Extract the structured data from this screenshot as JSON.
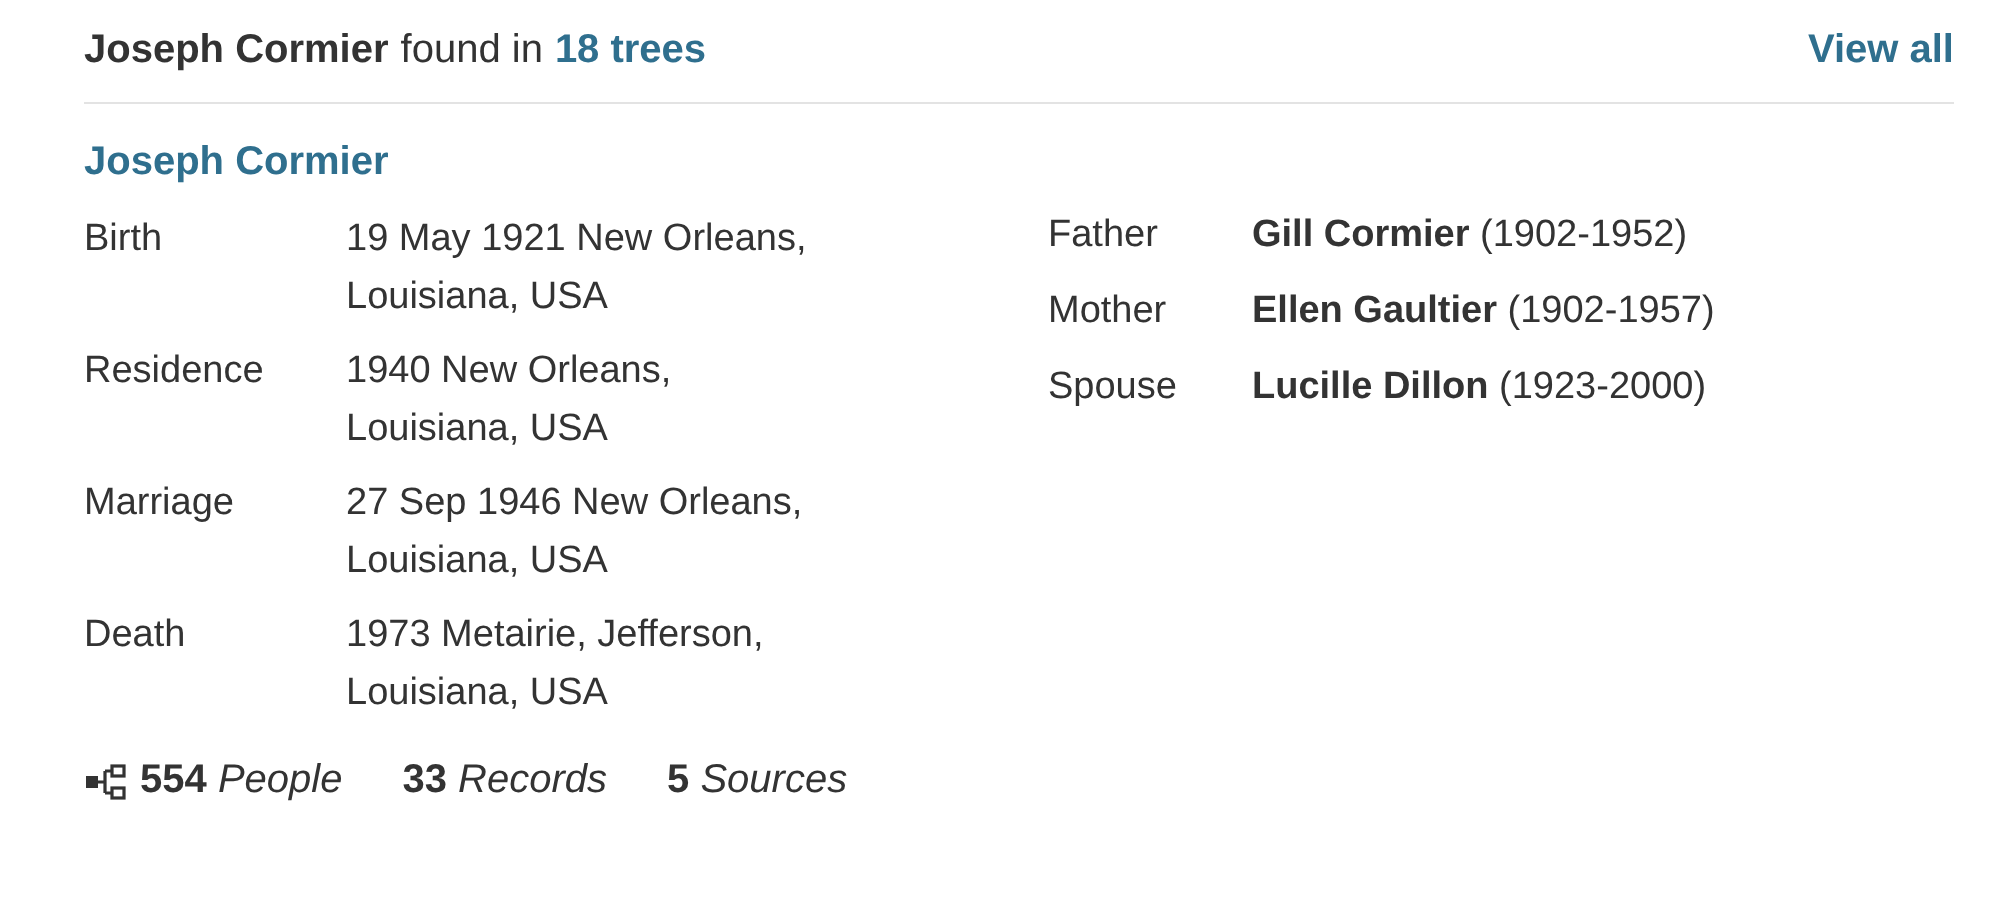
{
  "header": {
    "name": "Joseph Cormier",
    "found_in": "found in",
    "trees_link": "18 trees",
    "view_all": "View all"
  },
  "person": {
    "name": "Joseph Cormier"
  },
  "facts": [
    {
      "label": "Birth",
      "lines": [
        "19 May 1921 New Orleans,",
        "Louisiana, USA"
      ]
    },
    {
      "label": "Residence",
      "lines": [
        "1940 New Orleans,",
        "Louisiana, USA"
      ]
    },
    {
      "label": "Marriage",
      "lines": [
        "27 Sep 1946 New Orleans,",
        "Louisiana, USA"
      ]
    },
    {
      "label": "Death",
      "lines": [
        "1973 Metairie, Jefferson,",
        "Louisiana, USA"
      ]
    }
  ],
  "family": [
    {
      "relation": "Father",
      "name": "Gill Cormier",
      "years": "(1902-1952)"
    },
    {
      "relation": "Mother",
      "name": "Ellen Gaultier",
      "years": "(1902-1957)"
    },
    {
      "relation": "Spouse",
      "name": "Lucille Dillon",
      "years": "(1923-2000)"
    }
  ],
  "stats": [
    {
      "count": "554",
      "label": "People",
      "icon": true
    },
    {
      "count": "33",
      "label": "Records",
      "icon": false
    },
    {
      "count": "5",
      "label": "Sources",
      "icon": false
    }
  ]
}
